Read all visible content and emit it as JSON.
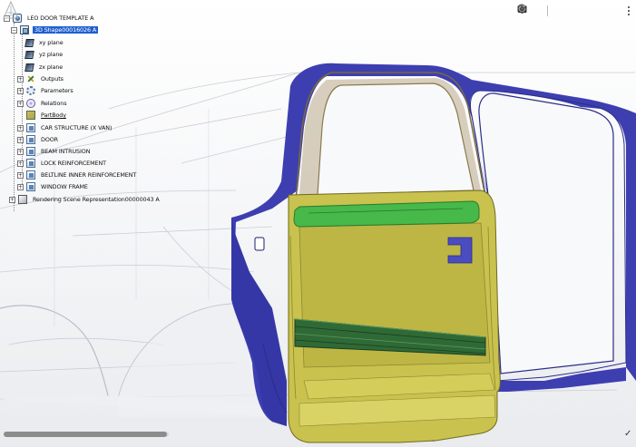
{
  "tree": {
    "root": "LEO DOOR TEMPLATE A",
    "selected": "3D Shape00016026 A",
    "planes": [
      "xy plane",
      "yz plane",
      "zx plane"
    ],
    "items": [
      "Outputs",
      "Parameters",
      "Relations",
      "PartBody"
    ],
    "parts": [
      "CAR STRUCTURE (X VAN)",
      "DOOR",
      "BEAM INTRUSION",
      "LOCK REINFORCEMENT",
      "BELTLINE INNER REINFORCEMENT",
      "WINDOW FRAME"
    ],
    "scene": "Rendering Scene Representation00000043 A"
  },
  "toolbar": {
    "icons": [
      "axis-icon",
      "zoom-icon",
      "view-cube-icon",
      "view-mode-icon",
      "camera-icon",
      "render-icon",
      "refresh-icon",
      "more-icon"
    ]
  },
  "colors": {
    "body": "#3d3fb0",
    "door": "#c9c24e",
    "beltline": "#47b84a",
    "beam": "#2f6a36",
    "selection": "#1f5fd1"
  },
  "scroll": {
    "position": 1.0
  },
  "marks": {
    "down_arrow": "⌃",
    "checkmark": "✓"
  }
}
